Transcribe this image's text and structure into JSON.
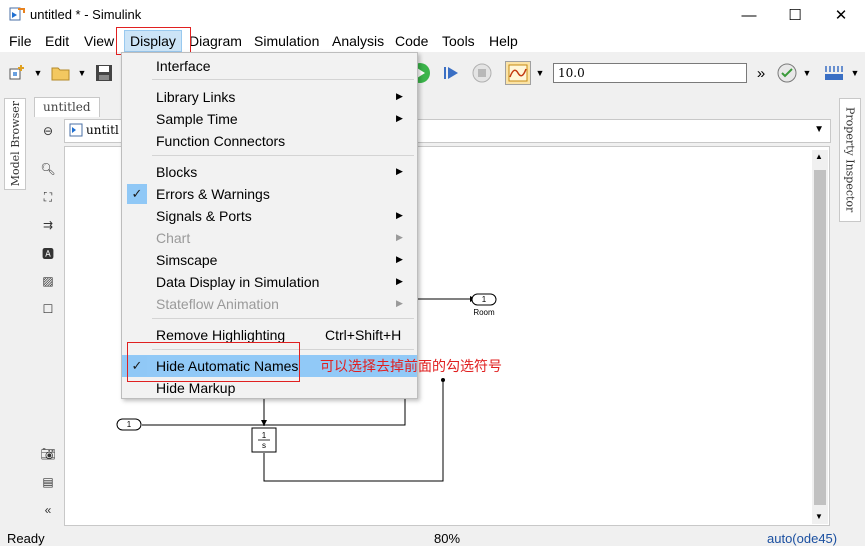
{
  "window": {
    "title": "untitled * - Simulink",
    "minimize_glyph": "—",
    "maximize_glyph": "☐",
    "close_glyph": "✕"
  },
  "menubar": {
    "items": [
      {
        "label": "File",
        "key": "F"
      },
      {
        "label": "Edit",
        "key": "E"
      },
      {
        "label": "View",
        "key": "V"
      },
      {
        "label": "Display",
        "key": "D"
      },
      {
        "label": "Diagram",
        "key": "D"
      },
      {
        "label": "Simulation",
        "key": "S"
      },
      {
        "label": "Analysis",
        "key": "A"
      },
      {
        "label": "Code",
        "key": "C"
      },
      {
        "label": "Tools",
        "key": "T"
      },
      {
        "label": "Help",
        "key": "H"
      }
    ]
  },
  "toolbar": {
    "stop_time": "10.0",
    "overflow_glyph": "»"
  },
  "side_tabs": {
    "model_browser": "Model Browser",
    "property_inspector": "Property Inspector"
  },
  "document": {
    "tab_label": "untitled",
    "breadcrumb": "untitl"
  },
  "display_menu": {
    "items": [
      {
        "label": "Interface",
        "submenu": false,
        "enabled": true,
        "checked": false,
        "shortcut": ""
      },
      {
        "label": "Library Links",
        "submenu": true,
        "enabled": true,
        "checked": false,
        "shortcut": ""
      },
      {
        "label": "Sample Time",
        "submenu": true,
        "enabled": true,
        "checked": false,
        "shortcut": ""
      },
      {
        "label": "Function Connectors",
        "submenu": false,
        "enabled": true,
        "checked": false,
        "shortcut": ""
      },
      {
        "label": "Blocks",
        "submenu": true,
        "enabled": true,
        "checked": false,
        "shortcut": ""
      },
      {
        "label": "Errors & Warnings",
        "submenu": false,
        "enabled": true,
        "checked": true,
        "shortcut": ""
      },
      {
        "label": "Signals & Ports",
        "submenu": true,
        "enabled": true,
        "checked": false,
        "shortcut": ""
      },
      {
        "label": "Chart",
        "submenu": true,
        "enabled": false,
        "checked": false,
        "shortcut": ""
      },
      {
        "label": "Simscape",
        "submenu": true,
        "enabled": true,
        "checked": false,
        "shortcut": ""
      },
      {
        "label": "Data Display in Simulation",
        "submenu": true,
        "enabled": true,
        "checked": false,
        "shortcut": ""
      },
      {
        "label": "Stateflow Animation",
        "submenu": true,
        "enabled": false,
        "checked": false,
        "shortcut": ""
      },
      {
        "label": "Remove Highlighting",
        "submenu": false,
        "enabled": true,
        "checked": false,
        "shortcut": "Ctrl+Shift+H"
      },
      {
        "label": "Hide Automatic Names",
        "submenu": false,
        "enabled": true,
        "checked": true,
        "shortcut": ""
      },
      {
        "label": "Hide Markup",
        "submenu": false,
        "enabled": true,
        "checked": false,
        "shortcut": ""
      }
    ],
    "submenu_glyph": "▶",
    "check_glyph": "✓"
  },
  "diagram": {
    "outport_number": "1",
    "outport_name": "Room",
    "inport_number": "1",
    "integrator_num": "1",
    "integrator_den": "s"
  },
  "annotation": "可以选择去掉前面的勾选符号",
  "status": {
    "state": "Ready",
    "zoom": "80%",
    "solver": "auto(ode45)"
  },
  "colors": {
    "annotation_red": "#e02020",
    "menu_highlight": "#91c9f7",
    "check_bg": "#90c8f6"
  }
}
